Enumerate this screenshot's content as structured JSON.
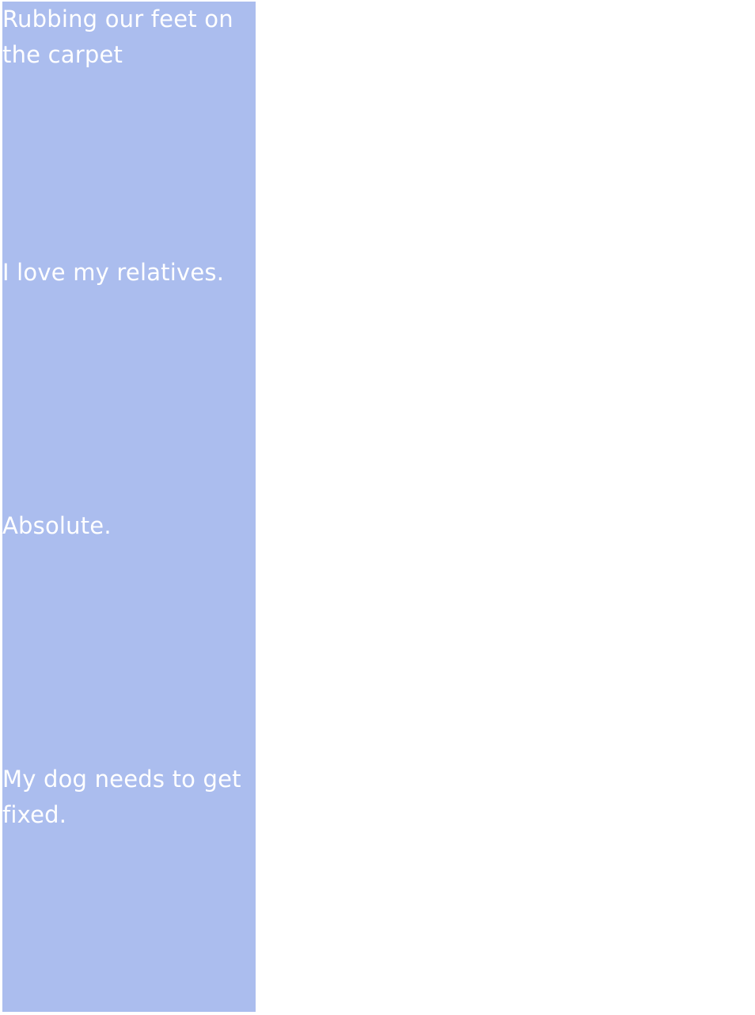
{
  "colors": {
    "panel_background": "#abbdee",
    "text": "#ffffff",
    "page_background": "#ffffff"
  },
  "items": [
    {
      "text": "Rubbing our feet on the carpet"
    },
    {
      "text": "I love my relatives."
    },
    {
      "text": "Absolute."
    },
    {
      "text": "My dog needs to get fixed."
    }
  ]
}
